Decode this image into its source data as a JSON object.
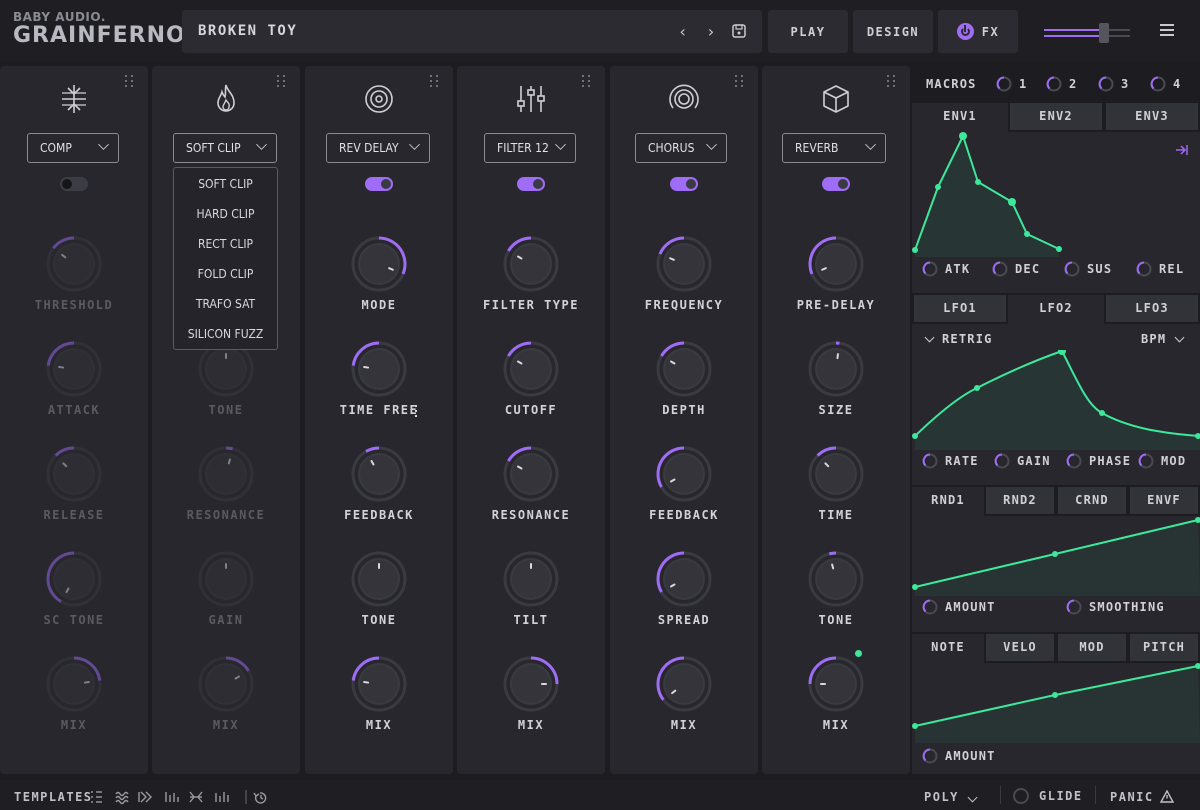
{
  "header": {
    "brand": "BABY AUDIO.",
    "product": "GRAINFERNO",
    "preset_name": "BROKEN TOY",
    "prev": "‹",
    "next": "›",
    "play": "PLAY",
    "design": "DESIGN",
    "fx": "FX",
    "master_level": 0.7
  },
  "modules": [
    {
      "icon": "compressor-icon",
      "type": "COMP",
      "enabled": false,
      "knobs": [
        "THRESHOLD",
        "ATTACK",
        "RELEASE",
        "SC TONE",
        "MIX"
      ]
    },
    {
      "icon": "flame-icon",
      "type": "SOFT CLIP",
      "enabled": false,
      "knobs": [
        "",
        "TONE",
        "RESONANCE",
        "GAIN",
        "MIX"
      ]
    },
    {
      "icon": "target-icon",
      "type": "REV DELAY",
      "enabled": true,
      "knobs": [
        "MODE",
        "TIME FREE",
        "FEEDBACK",
        "TONE",
        "MIX"
      ]
    },
    {
      "icon": "sliders-icon",
      "type": "FILTER 12",
      "enabled": true,
      "knobs": [
        "FILTER TYPE",
        "CUTOFF",
        "RESONANCE",
        "TILT",
        "MIX"
      ]
    },
    {
      "icon": "rings-icon",
      "type": "CHORUS",
      "enabled": true,
      "knobs": [
        "FREQUENCY",
        "DEPTH",
        "FEEDBACK",
        "SPREAD",
        "MIX"
      ]
    },
    {
      "icon": "cube-icon",
      "type": "REVERB",
      "enabled": true,
      "knobs": [
        "PRE-DELAY",
        "SIZE",
        "TIME",
        "TONE",
        "MIX"
      ]
    }
  ],
  "clip_menu": [
    "SOFT CLIP",
    "HARD CLIP",
    "RECT CLIP",
    "FOLD CLIP",
    "TRAFO SAT",
    "SILICON FUZZ"
  ],
  "macros": {
    "label": "MACROS",
    "items": [
      "1",
      "2",
      "3",
      "4"
    ]
  },
  "env": {
    "tabs": [
      "ENV1",
      "ENV2",
      "ENV3"
    ],
    "params": [
      "ATK",
      "DEC",
      "SUS",
      "REL"
    ]
  },
  "lfo": {
    "tabs": [
      "LFO1",
      "LFO2",
      "LFO3"
    ],
    "retrig": "RETRIG",
    "sync": "BPM",
    "params": [
      "RATE",
      "GAIN",
      "PHASE",
      "MOD"
    ]
  },
  "rnd": {
    "tabs": [
      "RND1",
      "RND2",
      "CRND",
      "ENVF"
    ],
    "params": [
      "AMOUNT",
      "SMOOTHING"
    ]
  },
  "note": {
    "tabs": [
      "NOTE",
      "VELO",
      "MOD",
      "PITCH"
    ],
    "params": [
      "AMOUNT"
    ]
  },
  "footer": {
    "templates": "TEMPLATES",
    "poly": "POLY",
    "glide": "GLIDE",
    "panic": "PANIC"
  },
  "colors": {
    "accent": "#9f6cf5",
    "mod": "#3de89a"
  }
}
